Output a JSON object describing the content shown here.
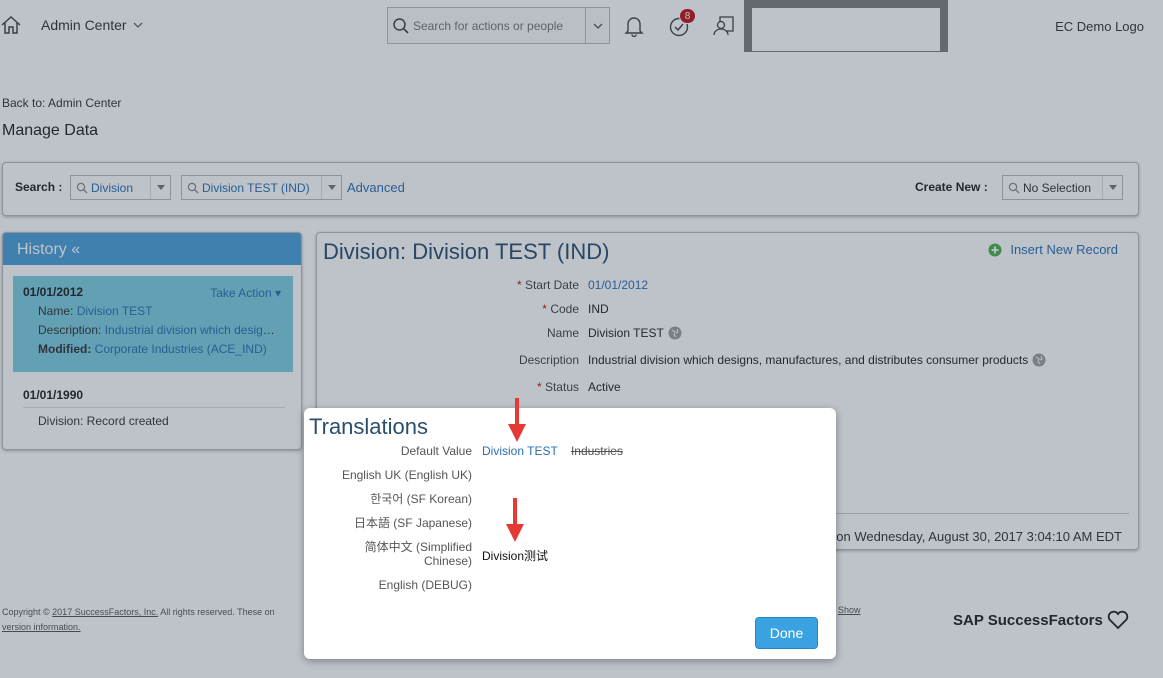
{
  "header": {
    "app_menu": "Admin Center",
    "search_placeholder": "Search for actions or people",
    "todo_count": "8",
    "company_logo": "EC Demo Logo"
  },
  "page": {
    "back_link": "Back to: Admin Center",
    "title": "Manage Data",
    "search_label": "Search :",
    "search_type": "Division",
    "search_record": "Division TEST (IND)",
    "advanced_link": "Advanced",
    "create_new_label": "Create New :",
    "create_new_value": "No Selection"
  },
  "history": {
    "title": "History «",
    "entries": [
      {
        "date": "01/01/2012",
        "take_action": "Take Action",
        "name_label": "Name:",
        "name_value": "Division TEST",
        "desc_label": "Description:",
        "desc_value": "Industrial division which designs, manufactures, and distributes consumer products",
        "modified_label": "Modified:",
        "modified_value": "Corporate Industries (ACE_IND)"
      },
      {
        "date": "01/01/1990",
        "line": "Division: Record created"
      }
    ]
  },
  "detail": {
    "title": "Division: Division TEST (IND)",
    "insert_new_record": "Insert New Record",
    "fields": [
      {
        "label": "Start Date",
        "required": true,
        "value": "01/01/2012"
      },
      {
        "label": "Code",
        "required": true,
        "value": "IND"
      },
      {
        "label": "Name",
        "required": false,
        "value": "Division TEST"
      },
      {
        "label": "Description",
        "required": false,
        "value": "Industrial division which designs, manufactures, and distributes consumer products"
      },
      {
        "label": "Status",
        "required": true,
        "value": "Active"
      }
    ],
    "last_modified": "on Wednesday, August 30, 2017 3:04:10 AM EDT"
  },
  "footer": {
    "copyright_prefix": "Copyright ©",
    "copyright_link": "2017 SuccessFactors, Inc.",
    "copyright_rest": "All rights reserved. These on",
    "version_link": "version information.",
    "show_link": "Show",
    "brand": "SAP SuccessFactors"
  },
  "dialog": {
    "title": "Translations",
    "rows": [
      {
        "label": "Default Value",
        "value": "Division TEST",
        "strike": "Industries"
      },
      {
        "label": "English UK (English UK)",
        "value": ""
      },
      {
        "label": "한국어 (SF Korean)",
        "value": ""
      },
      {
        "label": "日本語 (SF Japanese)",
        "value": ""
      },
      {
        "label_line1": "简体中文 (Simplified",
        "label_line2": "Chinese)",
        "value": "Division测试"
      },
      {
        "label": "English (DEBUG)",
        "value": ""
      }
    ],
    "done_label": "Done"
  },
  "colors": {
    "accent": "#3ba2e2",
    "link": "#2a6fb0",
    "history_header": "#4aa0d8",
    "history_active": "#7dcde0",
    "badge": "#c0141c",
    "arrow": "#e53935"
  }
}
